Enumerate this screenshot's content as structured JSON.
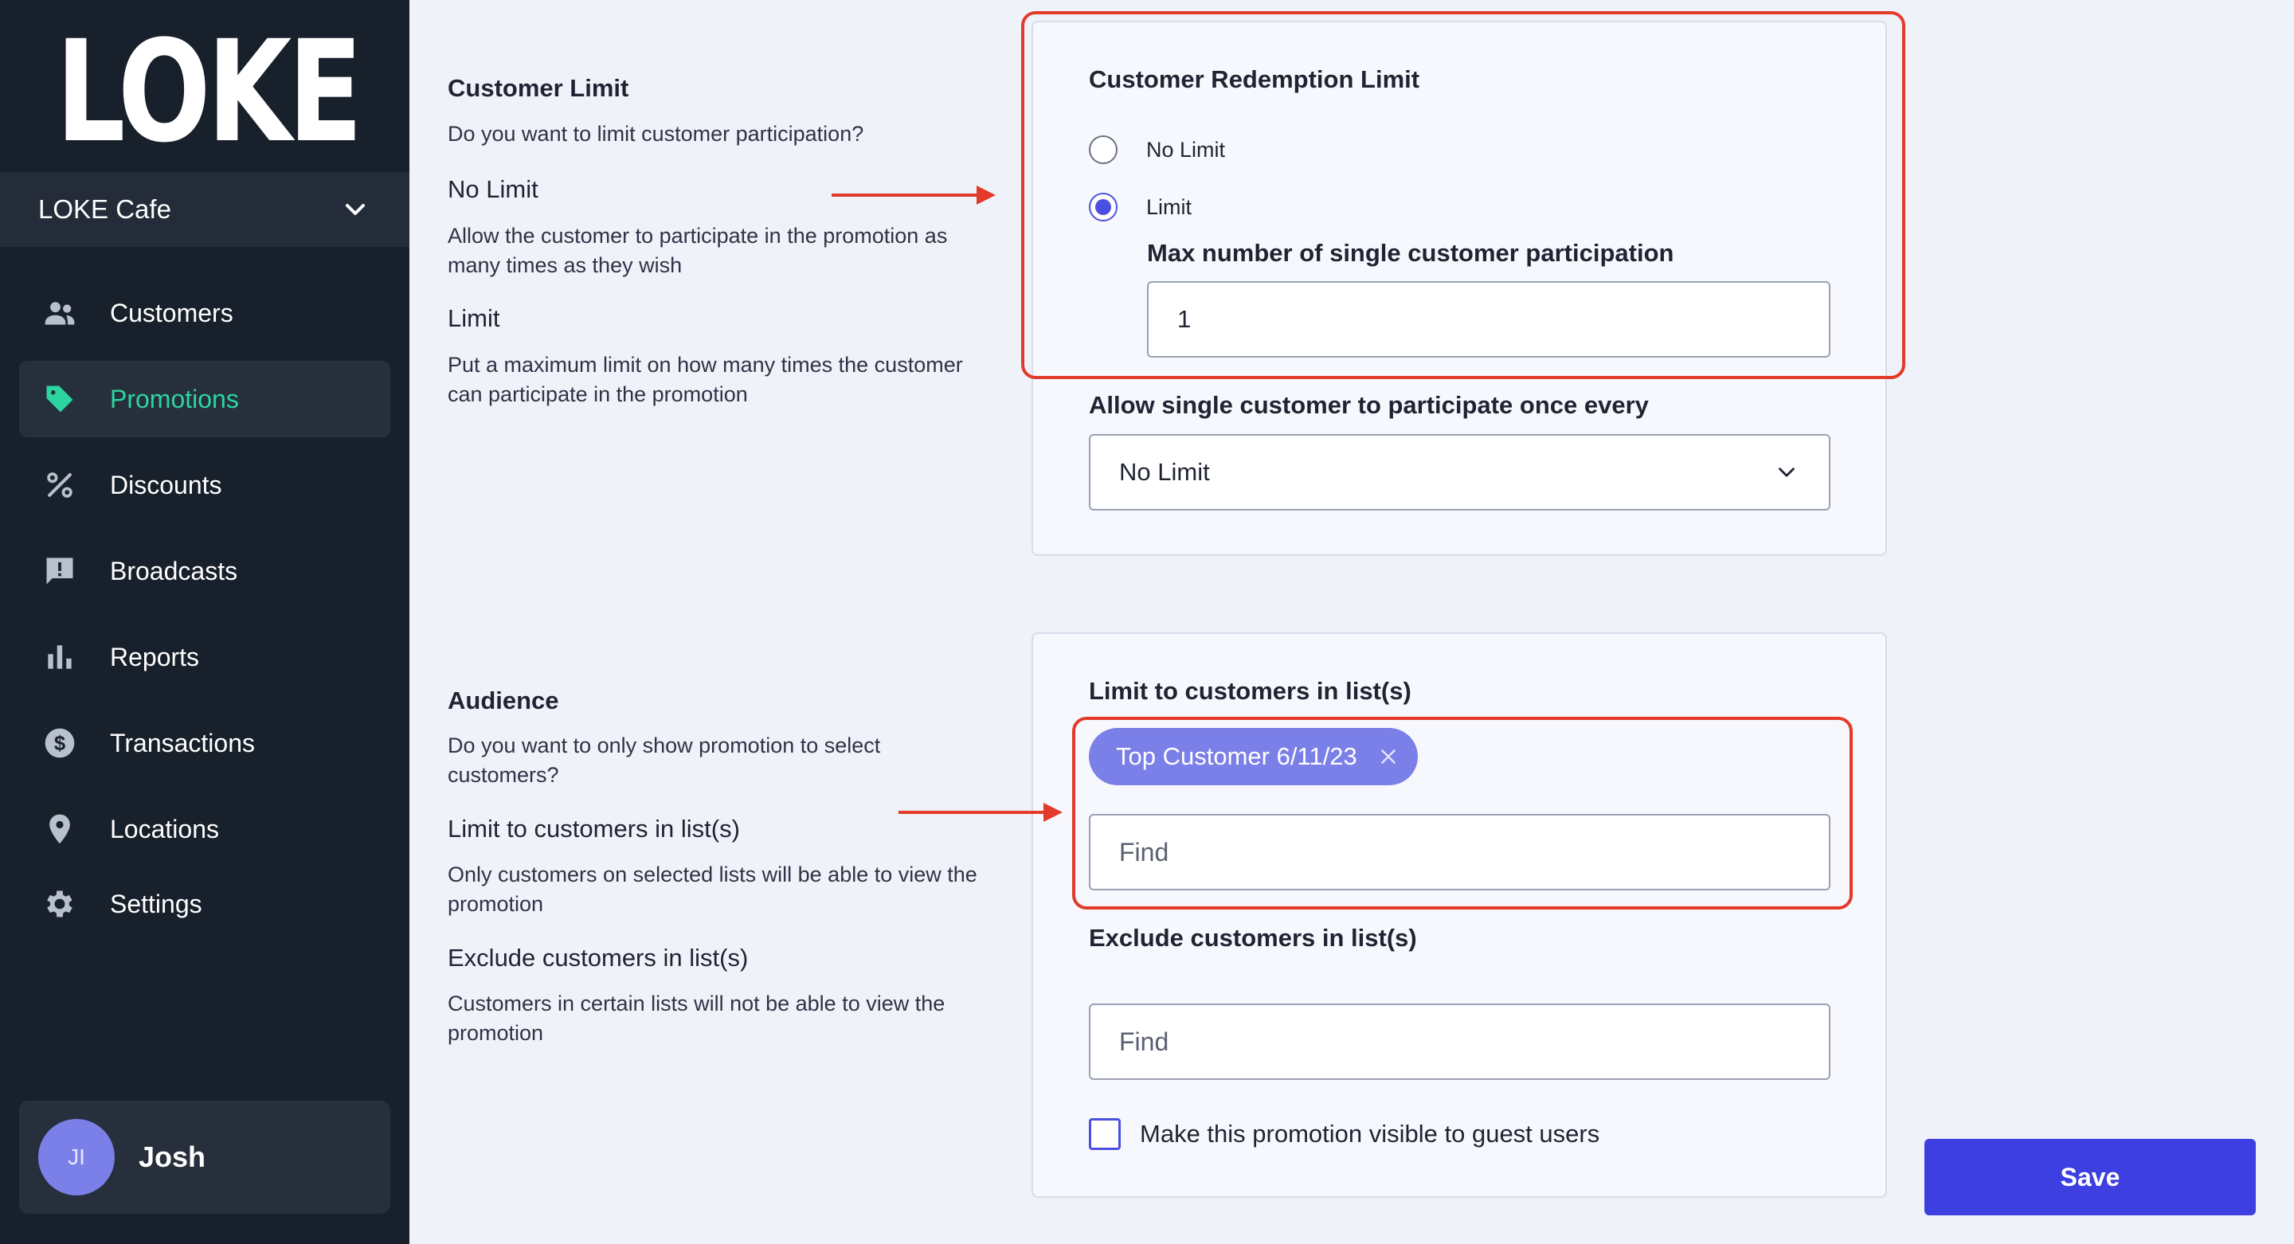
{
  "sidebar": {
    "logo": "LOKE",
    "venue": "LOKE Cafe",
    "items": [
      {
        "label": "Customers",
        "icon": "customers-icon"
      },
      {
        "label": "Promotions",
        "icon": "tag-icon",
        "active": true
      },
      {
        "label": "Discounts",
        "icon": "percent-icon"
      },
      {
        "label": "Broadcasts",
        "icon": "message-icon"
      },
      {
        "label": "Reports",
        "icon": "bar-chart-icon"
      },
      {
        "label": "Transactions",
        "icon": "dollar-icon"
      },
      {
        "label": "Locations",
        "icon": "location-pin-icon"
      },
      {
        "label": "Settings",
        "icon": "gear-icon"
      }
    ],
    "user": {
      "initials": "JI",
      "name": "Josh"
    }
  },
  "customer_limit": {
    "title": "Customer Limit",
    "question": "Do you want to limit customer participation?",
    "no_limit_heading": "No Limit",
    "no_limit_desc": "Allow the customer to participate in the promotion as many times as they wish",
    "limit_heading": "Limit",
    "limit_desc": "Put a maximum limit on how many times the customer can participate in the promotion",
    "card": {
      "title": "Customer Redemption Limit",
      "option_no_limit": "No Limit",
      "option_limit": "Limit",
      "selected": "Limit",
      "max_label": "Max number of single customer participation",
      "max_value": "1",
      "frequency_label": "Allow single customer to participate once every",
      "frequency_value": "No Limit"
    }
  },
  "audience": {
    "title": "Audience",
    "question": "Do you want to only show promotion to select customers?",
    "limit_heading": "Limit to customers in list(s)",
    "limit_desc": "Only customers on selected lists will be able to view the promotion",
    "exclude_heading": "Exclude customers in list(s)",
    "exclude_desc": "Customers in certain lists will not be able to view the promotion",
    "card": {
      "limit_label": "Limit to customers in list(s)",
      "selected_list": "Top Customer 6/11/23",
      "limit_placeholder": "Find",
      "exclude_label": "Exclude customers in list(s)",
      "exclude_placeholder": "Find",
      "guest_label": "Make this promotion visible to guest users",
      "guest_checked": false
    }
  },
  "actions": {
    "save": "Save"
  },
  "colors": {
    "sidebar_bg": "#18202b",
    "active_accent": "#2dd4a0",
    "primary": "#3d3fe0",
    "chip": "#7b7fe8",
    "annotation": "#e33a2a"
  }
}
